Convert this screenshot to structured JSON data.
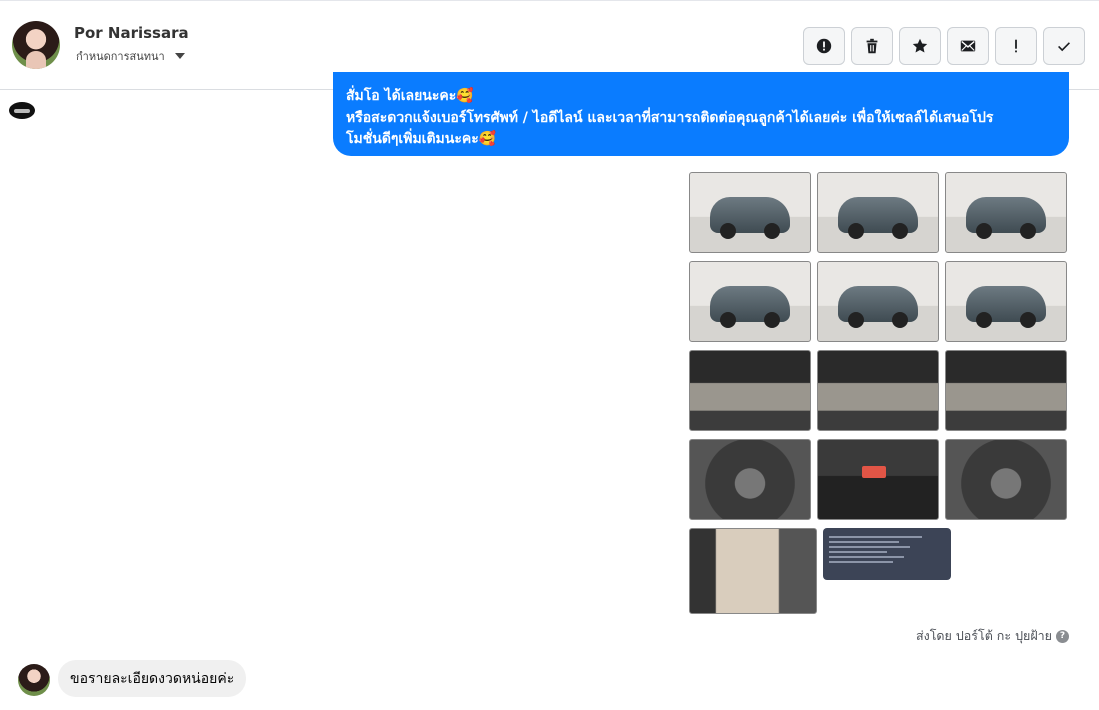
{
  "header": {
    "contact_name": "Por Narissara",
    "assign_label": "กำหนดการสนทนา",
    "actions": [
      {
        "id": "report",
        "icon": "alert-circle-icon",
        "label": "!"
      },
      {
        "id": "delete",
        "icon": "trash-icon",
        "label": ""
      },
      {
        "id": "star",
        "icon": "star-icon",
        "label": ""
      },
      {
        "id": "mail",
        "icon": "envelope-icon",
        "label": ""
      },
      {
        "id": "important",
        "icon": "exclamation-icon",
        "label": "!"
      },
      {
        "id": "done",
        "icon": "check-icon",
        "label": ""
      }
    ]
  },
  "thread": {
    "outgoing_lines": [
      "สั่มโอ ได้เลยนะคะ🥰",
      "หรือสะดวกแจ้งเบอร์โทรศัพท์ / ไอดีไลน์ และเวลาที่สามารถติดต่อคุณลูกค้าได้เลยค่ะ เพื่อให้เซลล์ได้เสนอโปร",
      "โมชั่นดีๆเพิ่มเติมนะคะ🥰"
    ],
    "photo_count": 14,
    "sent_by": "ส่งโดย ปอร์โต้ กะ ปุยฝ้าย",
    "help_glyph": "?",
    "incoming_message": "ขอรายละเอียดงวดหน่อยค่ะ"
  },
  "colors": {
    "outgoing_bubble": "#0a7cff",
    "incoming_bubble": "#f0f0f0"
  }
}
